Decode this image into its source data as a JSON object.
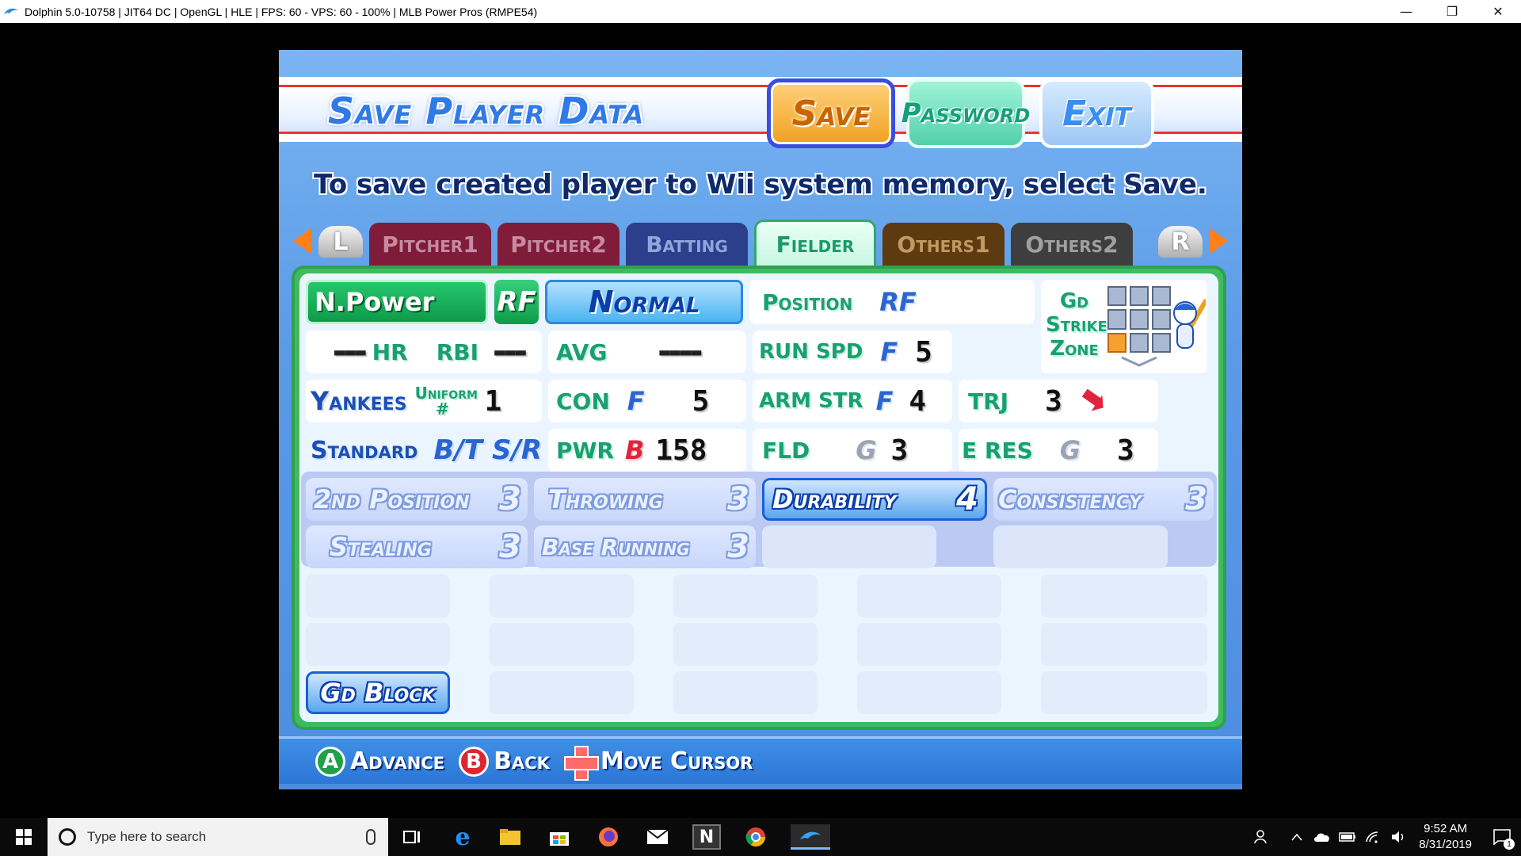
{
  "window": {
    "title": "Dolphin 5.0-10758 | JIT64 DC | OpenGL | HLE | FPS: 60 - VPS: 60 - 100% | MLB Power Pros (RMPE54)",
    "minimize": "—",
    "restore": "❐",
    "close": "✕"
  },
  "game": {
    "header_title": "Save Player Data",
    "buttons": {
      "save": "Save",
      "password": "Password",
      "exit": "Exit"
    },
    "instruction": "To save created player to Wii system memory, select Save.",
    "shoulder_left": "L",
    "shoulder_right": "R",
    "tabs": [
      "Pitcher1",
      "Pitcher2",
      "Batting",
      "Fielder",
      "Others1",
      "Others2"
    ],
    "player": {
      "name": "N.Power",
      "position_badge": "RF",
      "style": "Normal",
      "position_label": "Position",
      "position_value": "RF",
      "hr_value": "▬▬▬",
      "hr_label": "HR",
      "rbi_label": "RBI",
      "rbi_value": "▬▬▬",
      "avg_label": "AVG",
      "avg_value": "▬▬▬▬",
      "team": "Yankees",
      "uniform_label": "Uniform #",
      "uniform_value": "1",
      "form": "Standard",
      "bt_label": "B/T",
      "bt_value": "S/R"
    },
    "stats": {
      "run_spd": {
        "label": "RUN SPD",
        "grade": "F",
        "value": "5"
      },
      "con": {
        "label": "CON",
        "grade": "F",
        "value": "5"
      },
      "arm_str": {
        "label": "ARM STR",
        "grade": "F",
        "value": "4"
      },
      "trj": {
        "label": "TRJ",
        "value": "3"
      },
      "pwr": {
        "label": "PWR",
        "grade": "B",
        "value": "158"
      },
      "fld": {
        "label": "FLD",
        "grade": "G",
        "value": "3"
      },
      "e_res": {
        "label": "E RES",
        "grade": "G",
        "value": "3"
      }
    },
    "strike_zone_label": "Gd Strike Zone",
    "skills": [
      {
        "name": "2nd Position",
        "value": "3"
      },
      {
        "name": "Throwing",
        "value": "3"
      },
      {
        "name": "Durability",
        "value": "4"
      },
      {
        "name": "Consistency",
        "value": "3"
      },
      {
        "name": "Stealing",
        "value": "3"
      },
      {
        "name": "Base Running",
        "value": "3"
      }
    ],
    "gd_block": "Gd Block",
    "hints": {
      "a_btn": "A",
      "a_text": "Advance",
      "b_btn": "B",
      "b_text": "Back",
      "dpad_text": "Move Cursor"
    }
  },
  "taskbar": {
    "search_placeholder": "Type here to search",
    "time": "9:52 AM",
    "date": "8/31/2019",
    "notification_count": "1"
  },
  "colors": {
    "accent_blue": "#2a65d0",
    "fielder_green": "#1aa070",
    "save_orange": "#f0a020",
    "game_bg": "#5a9be7"
  }
}
